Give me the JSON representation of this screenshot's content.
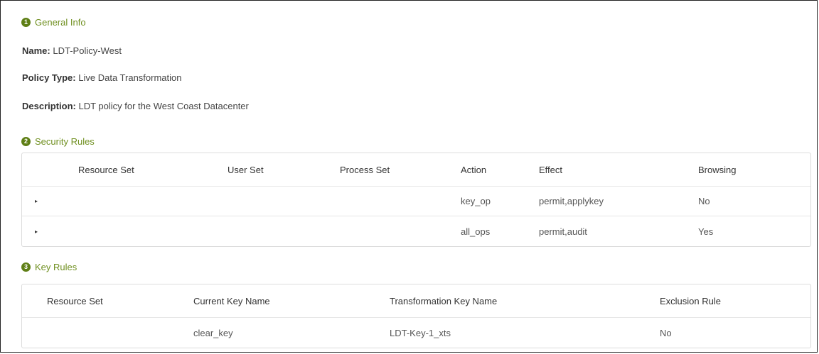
{
  "general": {
    "section_number": "1",
    "title": "General Info",
    "name_label": "Name:",
    "name_value": "LDT-Policy-West",
    "policy_type_label": "Policy Type:",
    "policy_type_value": "Live Data Transformation",
    "description_label": "Description:",
    "description_value": "LDT policy for the West Coast Datacenter"
  },
  "security_rules": {
    "section_number": "2",
    "title": "Security Rules",
    "columns": [
      "Resource Set",
      "User Set",
      "Process Set",
      "Action",
      "Effect",
      "Browsing"
    ],
    "rows": [
      {
        "expand_icon": "▸",
        "resource_set": "",
        "user_set": "",
        "process_set": "",
        "action": "key_op",
        "effect": "permit,applykey",
        "browsing": "No"
      },
      {
        "expand_icon": "▸",
        "resource_set": "",
        "user_set": "",
        "process_set": "",
        "action": "all_ops",
        "effect": "permit,audit",
        "browsing": "Yes"
      }
    ]
  },
  "key_rules": {
    "section_number": "3",
    "title": "Key Rules",
    "columns": [
      "Resource Set",
      "Current Key Name",
      "Transformation Key Name",
      "Exclusion Rule"
    ],
    "rows": [
      {
        "resource_set": "",
        "current_key_name": "clear_key",
        "transformation_key_name": "LDT-Key-1_xts",
        "exclusion_rule": "No"
      }
    ]
  },
  "colors": {
    "section_title": "#6f8f1f",
    "badge": "#5f7f16"
  }
}
